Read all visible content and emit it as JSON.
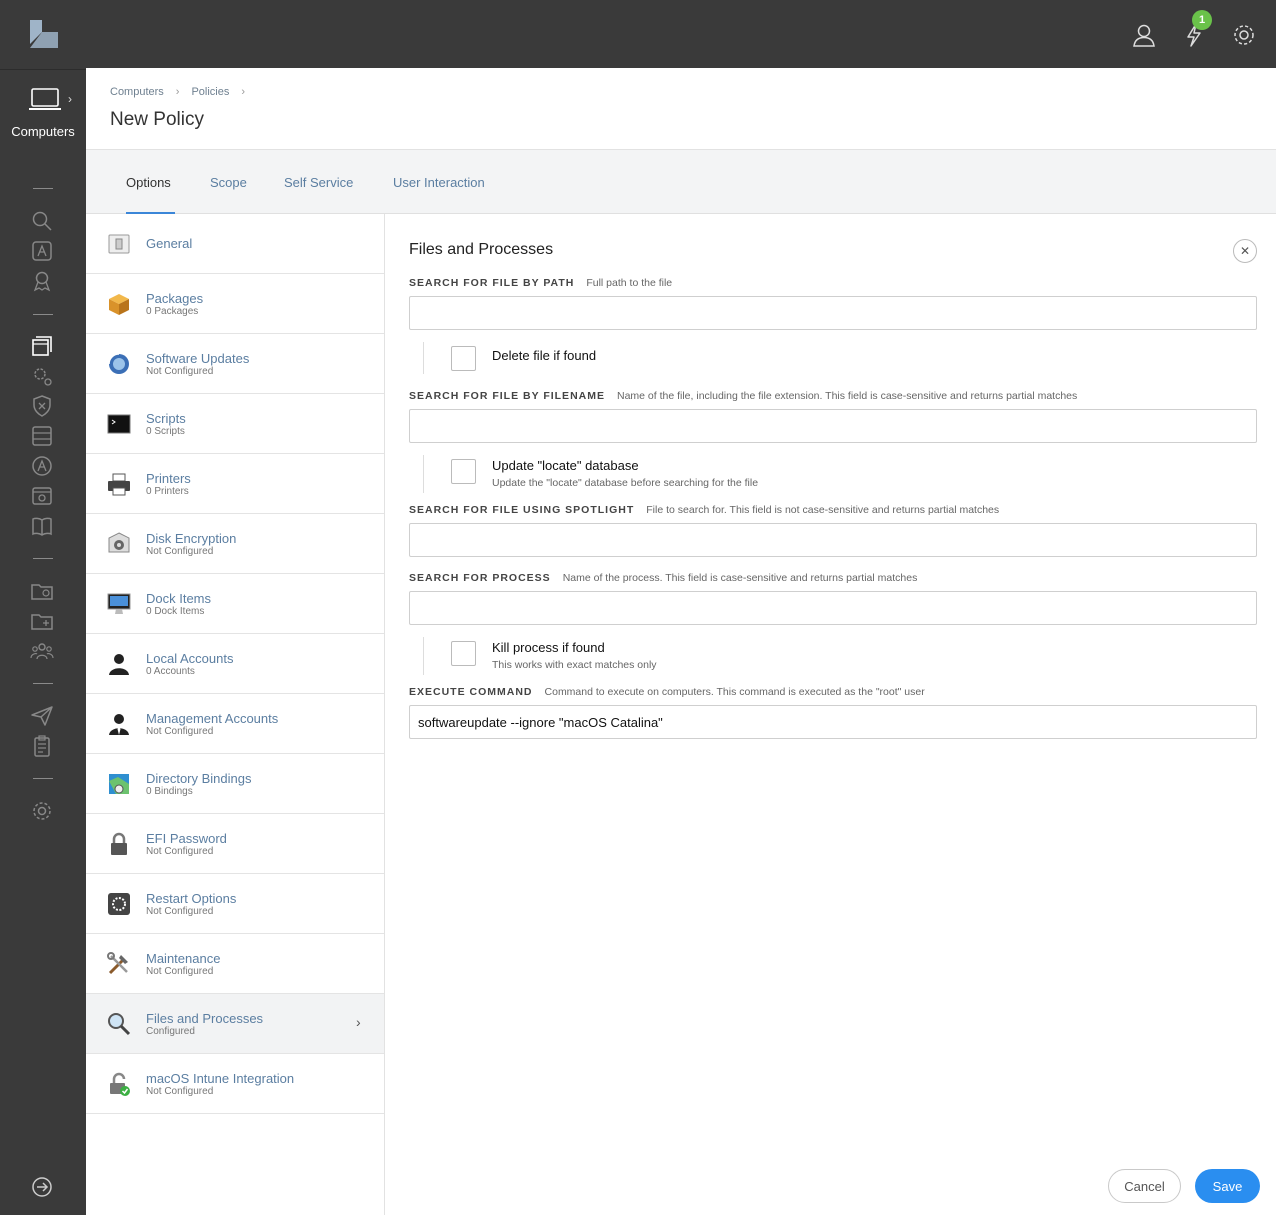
{
  "app": {
    "section_label": "Computers",
    "notifications_count": "1"
  },
  "breadcrumb": [
    "Computers",
    "Policies"
  ],
  "page_title": "New Policy",
  "tabs": [
    {
      "label": "Options",
      "active": true
    },
    {
      "label": "Scope",
      "active": false
    },
    {
      "label": "Self Service",
      "active": false
    },
    {
      "label": "User Interaction",
      "active": false
    }
  ],
  "payloads": [
    {
      "name": "General",
      "status": ""
    },
    {
      "name": "Packages",
      "status": "0 Packages"
    },
    {
      "name": "Software Updates",
      "status": "Not Configured"
    },
    {
      "name": "Scripts",
      "status": "0 Scripts"
    },
    {
      "name": "Printers",
      "status": "0 Printers"
    },
    {
      "name": "Disk Encryption",
      "status": "Not Configured"
    },
    {
      "name": "Dock Items",
      "status": "0 Dock Items"
    },
    {
      "name": "Local Accounts",
      "status": "0 Accounts"
    },
    {
      "name": "Management Accounts",
      "status": "Not Configured"
    },
    {
      "name": "Directory Bindings",
      "status": "0 Bindings"
    },
    {
      "name": "EFI Password",
      "status": "Not Configured"
    },
    {
      "name": "Restart Options",
      "status": "Not Configured"
    },
    {
      "name": "Maintenance",
      "status": "Not Configured"
    },
    {
      "name": "Files and Processes",
      "status": "Configured"
    },
    {
      "name": "macOS Intune Integration",
      "status": "Not Configured"
    }
  ],
  "files_processes": {
    "title": "Files and Processes",
    "search_path": {
      "label": "SEARCH FOR FILE BY PATH",
      "help": "Full path to the file",
      "value": ""
    },
    "delete_file": {
      "label": "Delete file if found",
      "checked": false
    },
    "search_filename": {
      "label": "SEARCH FOR FILE BY FILENAME",
      "help": "Name of the file, including the file extension. This field is case-sensitive and returns partial matches",
      "value": ""
    },
    "update_locate": {
      "label": "Update \"locate\" database",
      "sub": "Update the \"locate\" database before searching for the file",
      "checked": false
    },
    "search_spotlight": {
      "label": "SEARCH FOR FILE USING SPOTLIGHT",
      "help": "File to search for. This field is not case-sensitive and returns partial matches",
      "value": ""
    },
    "search_process": {
      "label": "SEARCH FOR PROCESS",
      "help": "Name of the process. This field is case-sensitive and returns partial matches",
      "value": ""
    },
    "kill_process": {
      "label": "Kill process if found",
      "sub": "This works with exact matches only",
      "checked": false
    },
    "execute_command": {
      "label": "EXECUTE COMMAND",
      "help": "Command to execute on computers. This command is executed as the \"root\" user",
      "value": "softwareupdate --ignore \"macOS Catalina\""
    }
  },
  "buttons": {
    "cancel": "Cancel",
    "save": "Save"
  },
  "colors": {
    "accent": "#2a8ef0",
    "badge": "#6ac24a",
    "chrome": "#3a3a3a",
    "link": "#5b7ea1"
  }
}
